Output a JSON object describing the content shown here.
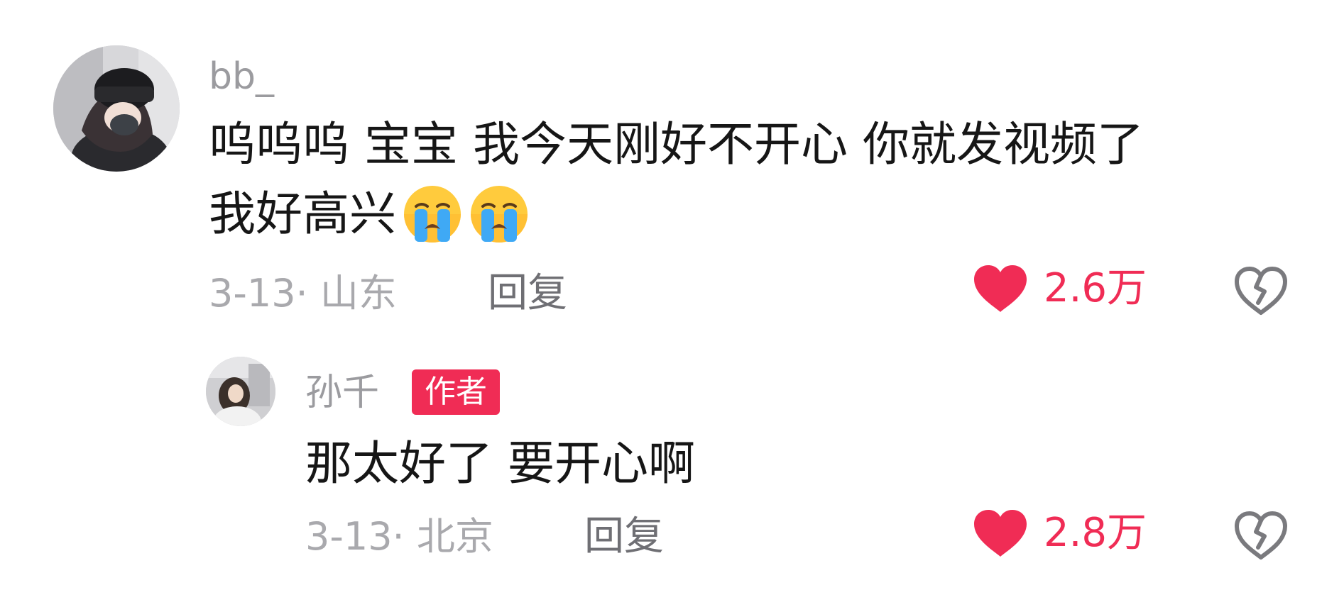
{
  "comment": {
    "username": "bb_",
    "text_line1": "呜呜呜 宝宝 我今天刚好不开心 你就发视频了",
    "text_line2": "我好高兴",
    "emoji_icon": "loudly-crying-face-icon",
    "meta": "3-13· 山东",
    "reply_label": "回复",
    "like_count": "2.6万",
    "like_color": "#f02c55"
  },
  "reply": {
    "username": "孙千",
    "badge": "作者",
    "badge_color": "#f02c55",
    "text": "那太好了 要开心啊",
    "meta": "3-13· 北京",
    "reply_label": "回复",
    "like_count": "2.8万"
  }
}
